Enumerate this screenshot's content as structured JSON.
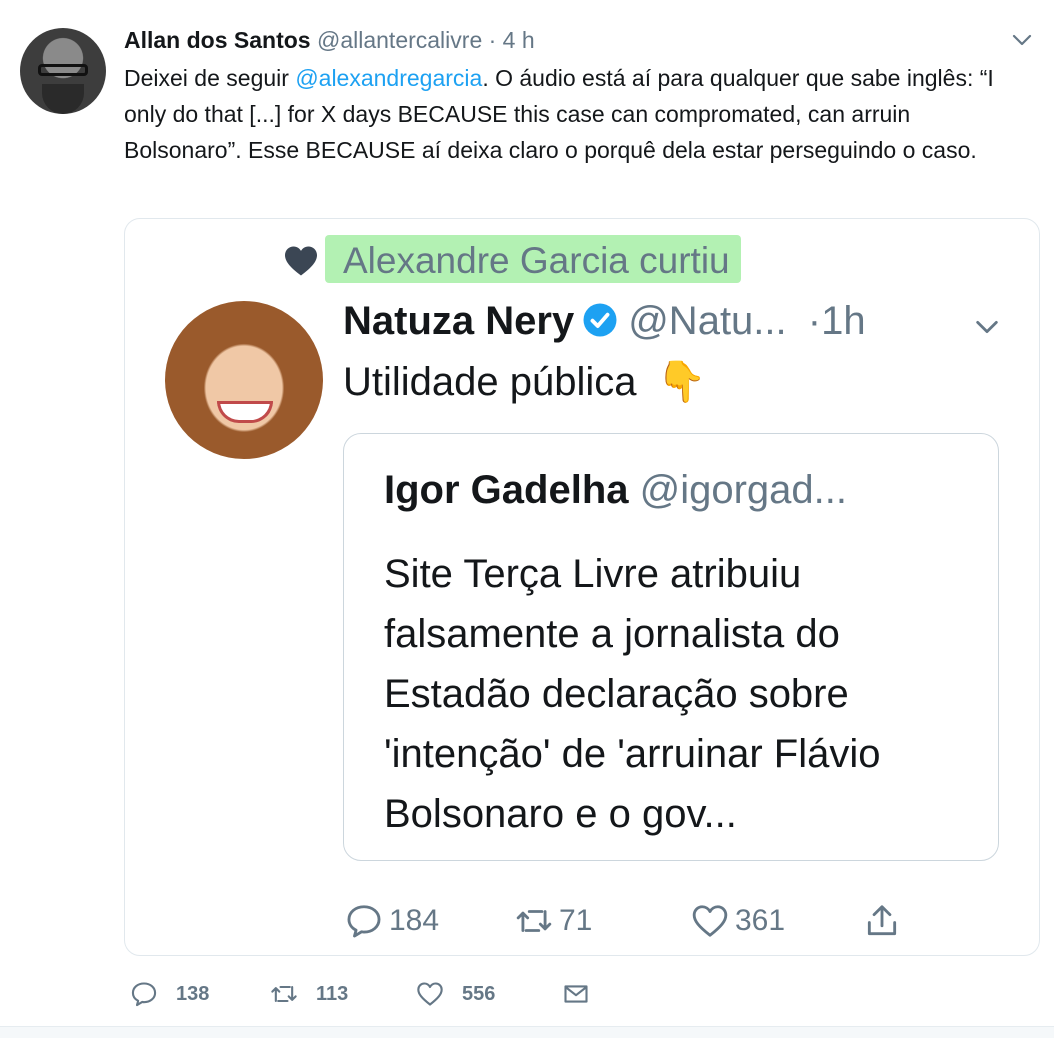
{
  "tweet": {
    "author_name": "Allan dos Santos",
    "author_handle": "@allantercalivre",
    "time": "· 4 h",
    "text_before": "Deixei de seguir ",
    "mention": "@alexandregarcia",
    "text_after": ". O áudio está aí para qualquer que sabe inglês: “I only do that [...] for X days BECAUSE this case can compromated, can arruin Bolsonaro”. Esse BECAUSE aí deixa claro o porquê dela estar perseguindo o caso.",
    "icons": {
      "menu": "chevron-down-icon",
      "reply": "reply-icon",
      "retweet": "retweet-icon",
      "like": "heart-icon",
      "dm": "envelope-icon"
    },
    "stats": {
      "replies": "138",
      "retweets": "113",
      "likes": "556"
    }
  },
  "embedded": {
    "liked_by": "Alexandre Garcia curtiu",
    "highlight_color": "#74e674",
    "author_name": "Natuza Nery",
    "author_handle": "@Natu...",
    "time": "·1h",
    "text": "Utilidade pública",
    "emoji": "👇",
    "quote": {
      "author_name": "Igor Gadelha",
      "author_handle": "@igorgad...",
      "text": "Site Terça Livre atribuiu falsamente a jornalista do Estadão declaração sobre 'intenção' de 'arruinar Flávio Bolsonaro e o gov..."
    },
    "stats": {
      "replies": "184",
      "retweets": "71",
      "likes": "361"
    }
  },
  "colors": {
    "link": "#1da1f2",
    "muted": "#657786",
    "text": "#14171a",
    "verified": "#1da1f2"
  }
}
